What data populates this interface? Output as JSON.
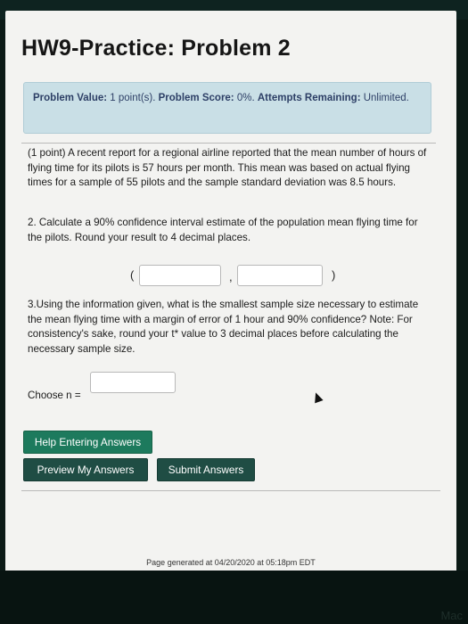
{
  "page": {
    "title": "HW9-Practice: Problem 2"
  },
  "info": {
    "value_label": "Problem Value:",
    "value": "1 point(s).",
    "score_label": "Problem Score:",
    "score": "0%.",
    "attempts_label": "Attempts Remaining:",
    "attempts": "Unlimited."
  },
  "problem": {
    "intro": "(1 point) A recent report for a regional airline reported that the mean number of hours of flying time for its pilots is 57 hours per month. This mean was based on actual flying times for a sample of 55 pilots and the sample standard deviation was 8.5 hours.",
    "q2": "2. Calculate a 90% confidence interval estimate of the population mean flying time for the pilots. Round your result to 4 decimal places.",
    "ci_open": "(",
    "ci_sep": ",",
    "ci_close": ")",
    "ci_lower": "",
    "ci_upper": "",
    "q3": "3.Using the information given, what is the smallest sample size necessary to estimate the mean flying time with a margin of error of 1 hour and 90% confidence? Note: For consistency's sake, round your t* value to 3 decimal places before calculating the necessary sample size.",
    "choose_label": "Choose n =",
    "n_value": ""
  },
  "buttons": {
    "help": "Help Entering Answers",
    "preview": "Preview My Answers",
    "submit": "Submit Answers"
  },
  "footer": {
    "generated": "Page generated at 04/20/2020 at 05:18pm EDT"
  },
  "bezel": {
    "label": "Mac"
  },
  "colors": {
    "info_bg": "#c9dfe6",
    "info_text": "#2d3f66",
    "button_green": "#1d7a5d",
    "button_dark": "#1f4d44"
  }
}
